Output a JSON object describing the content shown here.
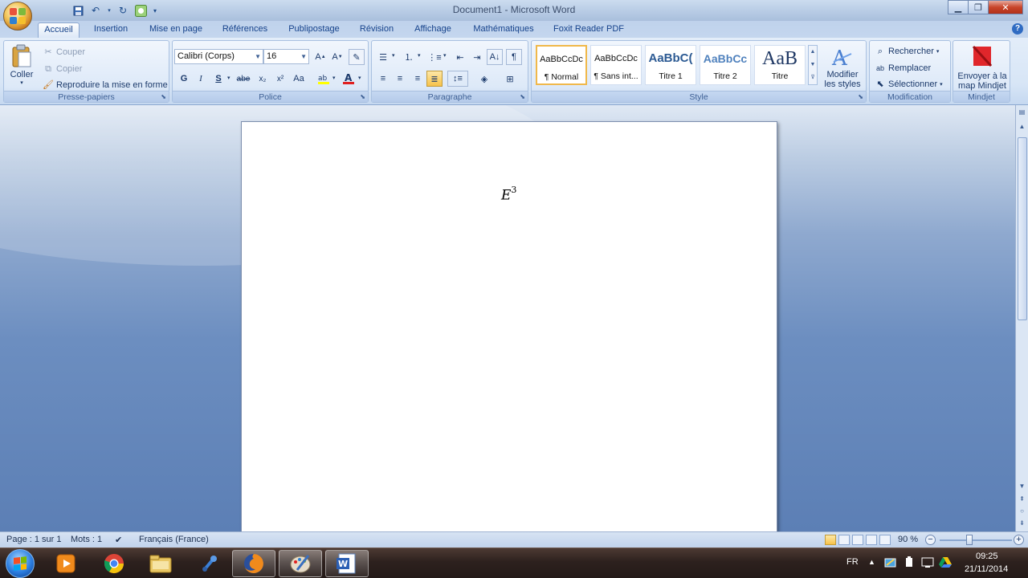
{
  "window": {
    "title": "Document1 - Microsoft Word"
  },
  "tabs": [
    {
      "label": "Accueil"
    },
    {
      "label": "Insertion"
    },
    {
      "label": "Mise en page"
    },
    {
      "label": "Références"
    },
    {
      "label": "Publipostage"
    },
    {
      "label": "Révision"
    },
    {
      "label": "Affichage"
    },
    {
      "label": "Mathématiques"
    },
    {
      "label": "Foxit Reader PDF"
    }
  ],
  "clipboard": {
    "paste": "Coller",
    "cut": "Couper",
    "copy": "Copier",
    "format_painter": "Reproduire la mise en forme",
    "group_label": "Presse-papiers"
  },
  "font": {
    "font_name": "Calibri (Corps)",
    "font_size": "16",
    "bold": "G",
    "italic": "I",
    "underline": "S",
    "strike": "abe",
    "subscript": "x₂",
    "superscript": "x²",
    "case": "Aa",
    "group_label": "Police"
  },
  "paragraph": {
    "group_label": "Paragraphe"
  },
  "styles": {
    "items": [
      {
        "preview": "AaBbCcDc",
        "name": "¶ Normal"
      },
      {
        "preview": "AaBbCcDc",
        "name": "¶ Sans int..."
      },
      {
        "preview": "AaBbC(",
        "name": "Titre 1"
      },
      {
        "preview": "AaBbCc",
        "name": "Titre 2"
      },
      {
        "preview": "AaB",
        "name": "Titre"
      }
    ],
    "modify_line1": "Modifier",
    "modify_line2": "les styles",
    "group_label": "Style"
  },
  "editing": {
    "find": "Rechercher",
    "replace": "Remplacer",
    "select": "Sélectionner",
    "group_label": "Modification"
  },
  "mindjet": {
    "line1": "Envoyer à la",
    "line2": "map Mindjet",
    "group_label": "Mindjet"
  },
  "document": {
    "equation_base": "E",
    "equation_exp": "3"
  },
  "status": {
    "page": "Page : 1 sur 1",
    "words": "Mots : 1",
    "language": "Français (France)",
    "zoom": "90 %"
  },
  "taskbar": {
    "lang": "FR",
    "time": "09:25",
    "date": "21/11/2014"
  },
  "colors": {
    "accent": "#15428b",
    "ribbon": "#dde9f8",
    "selected": "#f7c24a",
    "taskbar": "#2d211e"
  }
}
